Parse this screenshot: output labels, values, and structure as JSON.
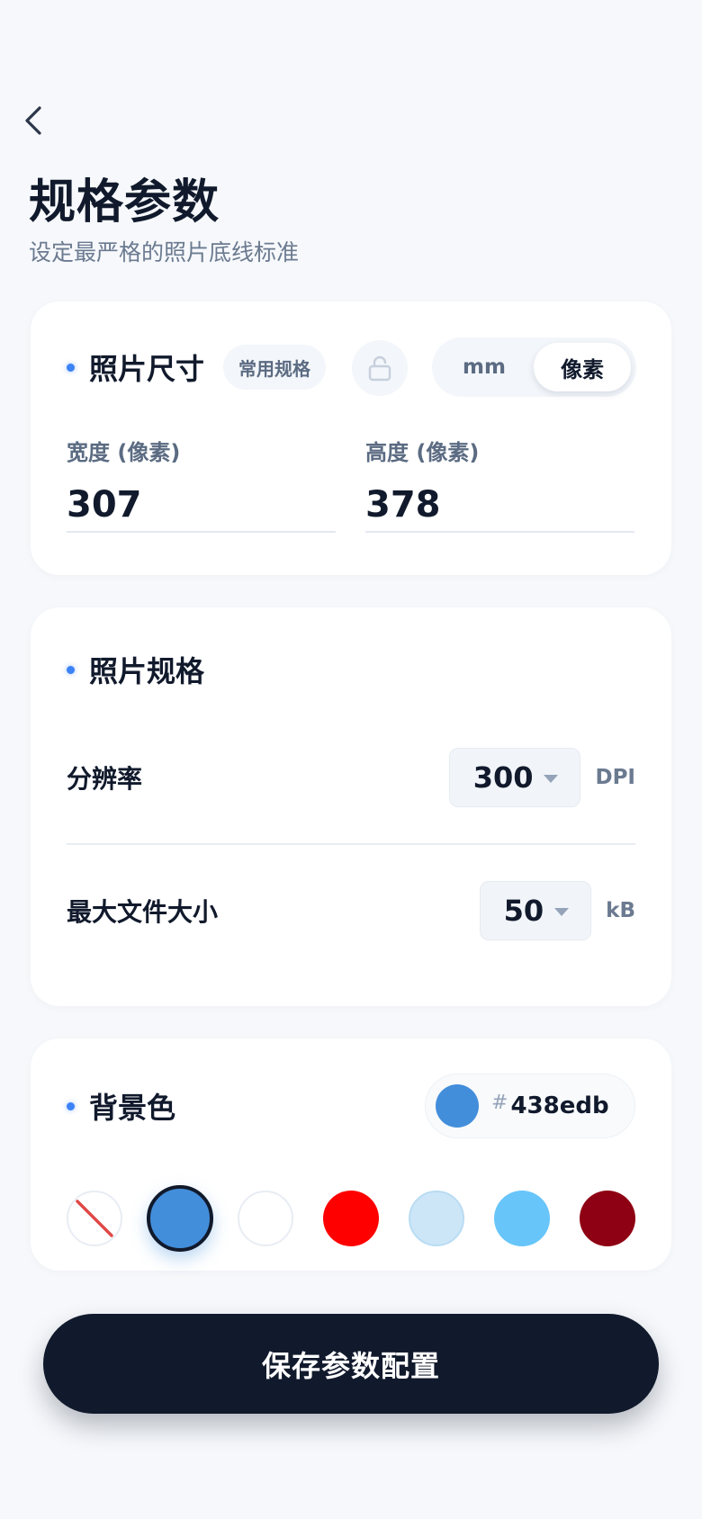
{
  "header": {
    "back_icon": "chevron-left-icon",
    "title": "规格参数",
    "subtitle": "设定最严格的照片底线标准"
  },
  "size_card": {
    "title": "照片尺寸",
    "preset_chip": "常用规格",
    "lock_icon": "unlock-icon",
    "unit_options": [
      "mm",
      "像素"
    ],
    "unit_selected": "像素",
    "width_label": "宽度 (像素)",
    "width_value": "307",
    "height_label": "高度 (像素)",
    "height_value": "378"
  },
  "spec_card": {
    "title": "照片规格",
    "resolution_label": "分辨率",
    "resolution_value": "300",
    "resolution_unit": "DPI",
    "max_size_label": "最大文件大小",
    "max_size_value": "50",
    "max_size_unit": "kB"
  },
  "bg_card": {
    "title": "背景色",
    "hash": "#",
    "selected_hex": "438edb",
    "selected_color": "#438edb",
    "swatches": [
      {
        "name": "none",
        "color": "transparent"
      },
      {
        "name": "blue",
        "color": "#438edb",
        "selected": true
      },
      {
        "name": "white",
        "color": "#ffffff"
      },
      {
        "name": "red",
        "color": "#ff0000"
      },
      {
        "name": "light-blue",
        "color": "#cce6f8"
      },
      {
        "name": "sky-blue",
        "color": "#67c5fa"
      },
      {
        "name": "dark-red",
        "color": "#8e0013"
      }
    ]
  },
  "save_button": "保存参数配置"
}
